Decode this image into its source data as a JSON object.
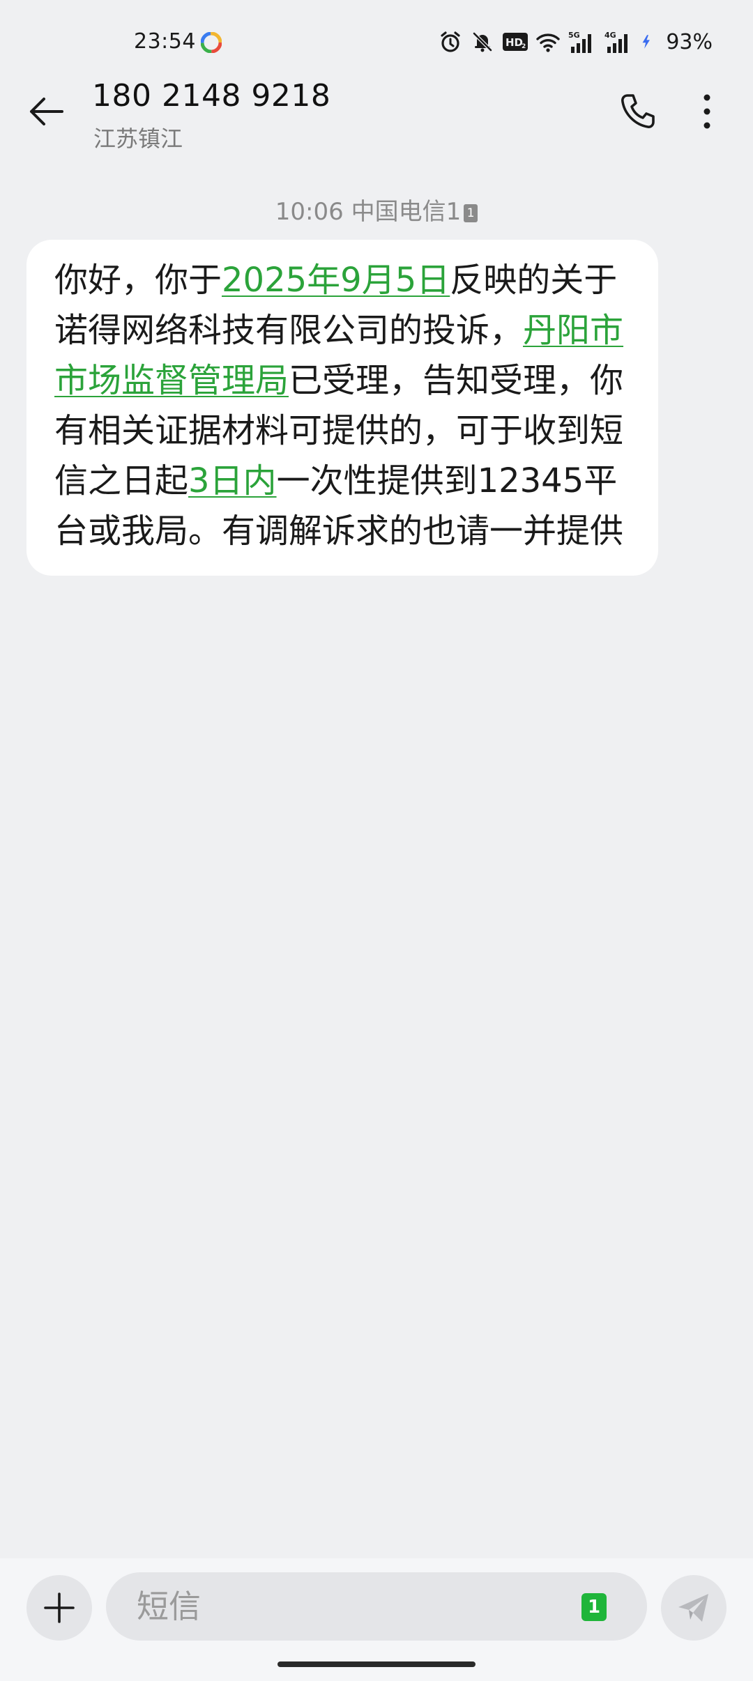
{
  "status_bar": {
    "time": "23:54",
    "battery": "93%",
    "network_labels": [
      "5G",
      "4G"
    ],
    "icons": [
      "app-icon",
      "alarm-icon",
      "mute-icon",
      "hd-icon",
      "wifi-icon",
      "signal-5g-icon",
      "signal-4g-icon",
      "charging-icon"
    ]
  },
  "header": {
    "number": "180 2148 9218",
    "location": "江苏镇江",
    "icons": [
      "back-arrow-icon",
      "phone-icon",
      "more-vertical-icon"
    ]
  },
  "conversation": {
    "meta": {
      "time": "10:06",
      "carrier": "中国电信1",
      "sim": "1"
    },
    "message": {
      "segments": [
        {
          "text": "你好，你于",
          "link": false
        },
        {
          "text": "2025年9月5日",
          "link": true
        },
        {
          "text": "反映的关于诺得网络科技有限公司的投诉，",
          "link": false
        },
        {
          "text": "丹阳市市场监督管理局",
          "link": true
        },
        {
          "text": "已受理，告知受理，你有相关证据材料可提供的，可于收到短信之日起",
          "link": false
        },
        {
          "text": "3日内",
          "link": true
        },
        {
          "text": "一次性提供到12345平台或我局。有调解诉求的也请一并提供",
          "link": false
        }
      ]
    }
  },
  "composer": {
    "placeholder": "短信",
    "value": "",
    "sim": "1",
    "icons": [
      "plus-icon",
      "send-icon"
    ]
  },
  "colors": {
    "background": "#eff0f2",
    "bubble": "#ffffff",
    "link": "#2ba33a",
    "sim_badge": "#1fb53a",
    "charging": "#3a6cf0"
  }
}
